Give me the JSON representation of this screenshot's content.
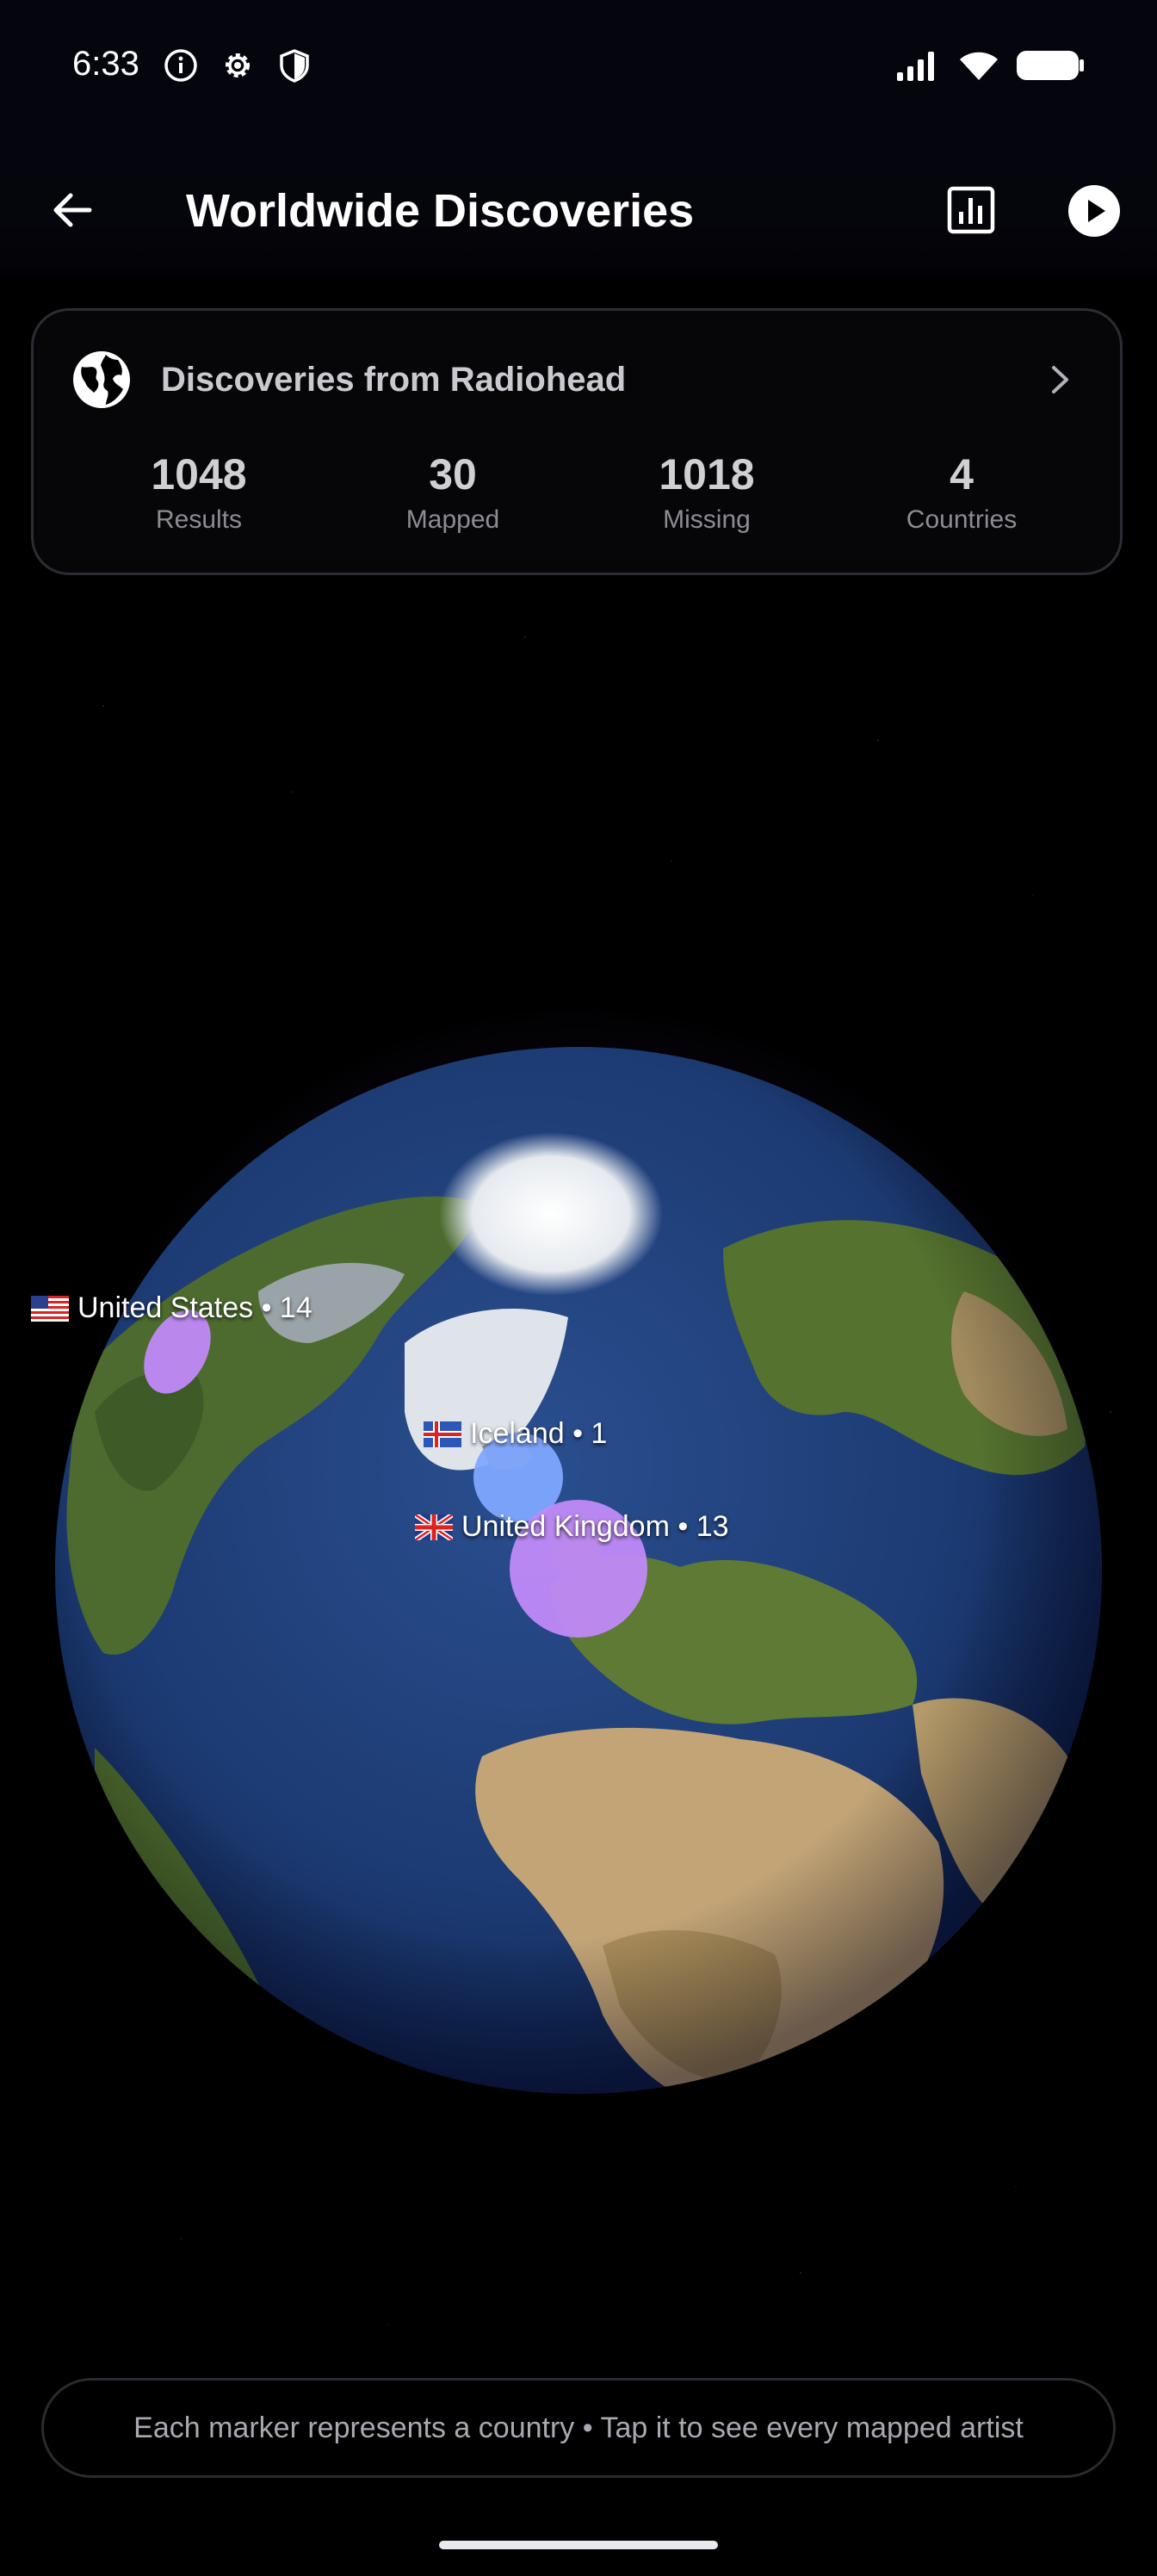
{
  "status_bar": {
    "time": "6:33"
  },
  "app_bar": {
    "title": "Worldwide Discoveries"
  },
  "summary": {
    "title": "Discoveries from Radiohead",
    "stats": [
      {
        "value": "1048",
        "label": "Results"
      },
      {
        "value": "30",
        "label": "Mapped"
      },
      {
        "value": "1018",
        "label": "Missing"
      },
      {
        "value": "4",
        "label": "Countries"
      }
    ]
  },
  "map": {
    "markers": [
      {
        "country": "United States",
        "label": "United States • 14",
        "count": 14,
        "color": "#c08af8"
      },
      {
        "country": "Iceland",
        "label": "Iceland • 1",
        "count": 1,
        "color": "#7fa7ff"
      },
      {
        "country": "United Kingdom",
        "label": "United Kingdom • 13",
        "count": 13,
        "color": "#c08af8"
      }
    ]
  },
  "footer": {
    "hint": "Each marker represents a country • Tap it to see every mapped artist"
  },
  "colors": {
    "background": "#000000",
    "ocean": "#1f3f7a",
    "halo": "#8c50c8",
    "marker_purple": "#c08af8",
    "marker_blue": "#7fa7ff"
  }
}
